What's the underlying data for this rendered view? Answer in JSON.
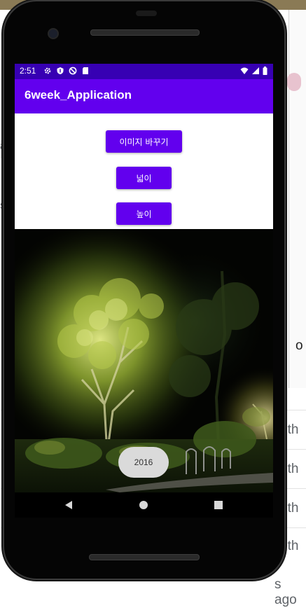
{
  "background_page": {
    "fragments": [
      "a",
      "s",
      "o",
      "nth",
      "nth",
      "nth",
      "nth",
      "s ago"
    ]
  },
  "status_bar": {
    "time": "2:51",
    "left_icons": [
      "gear-icon",
      "shield-icon",
      "no-sync-icon",
      "sd-card-icon"
    ],
    "right_icons": [
      "wifi-icon",
      "signal-icon",
      "battery-icon"
    ],
    "color": "#3700b3"
  },
  "app_bar": {
    "title": "6week_Application",
    "color": "#6200ee"
  },
  "buttons": {
    "change_image": "이미지 바꾸기",
    "width": "넓이",
    "height": "높이"
  },
  "image": {
    "description_icon": "night-garden-photo"
  },
  "toast": {
    "text": "2016"
  },
  "nav_bar": {
    "icons": [
      "back-icon",
      "home-icon",
      "recents-icon"
    ]
  }
}
